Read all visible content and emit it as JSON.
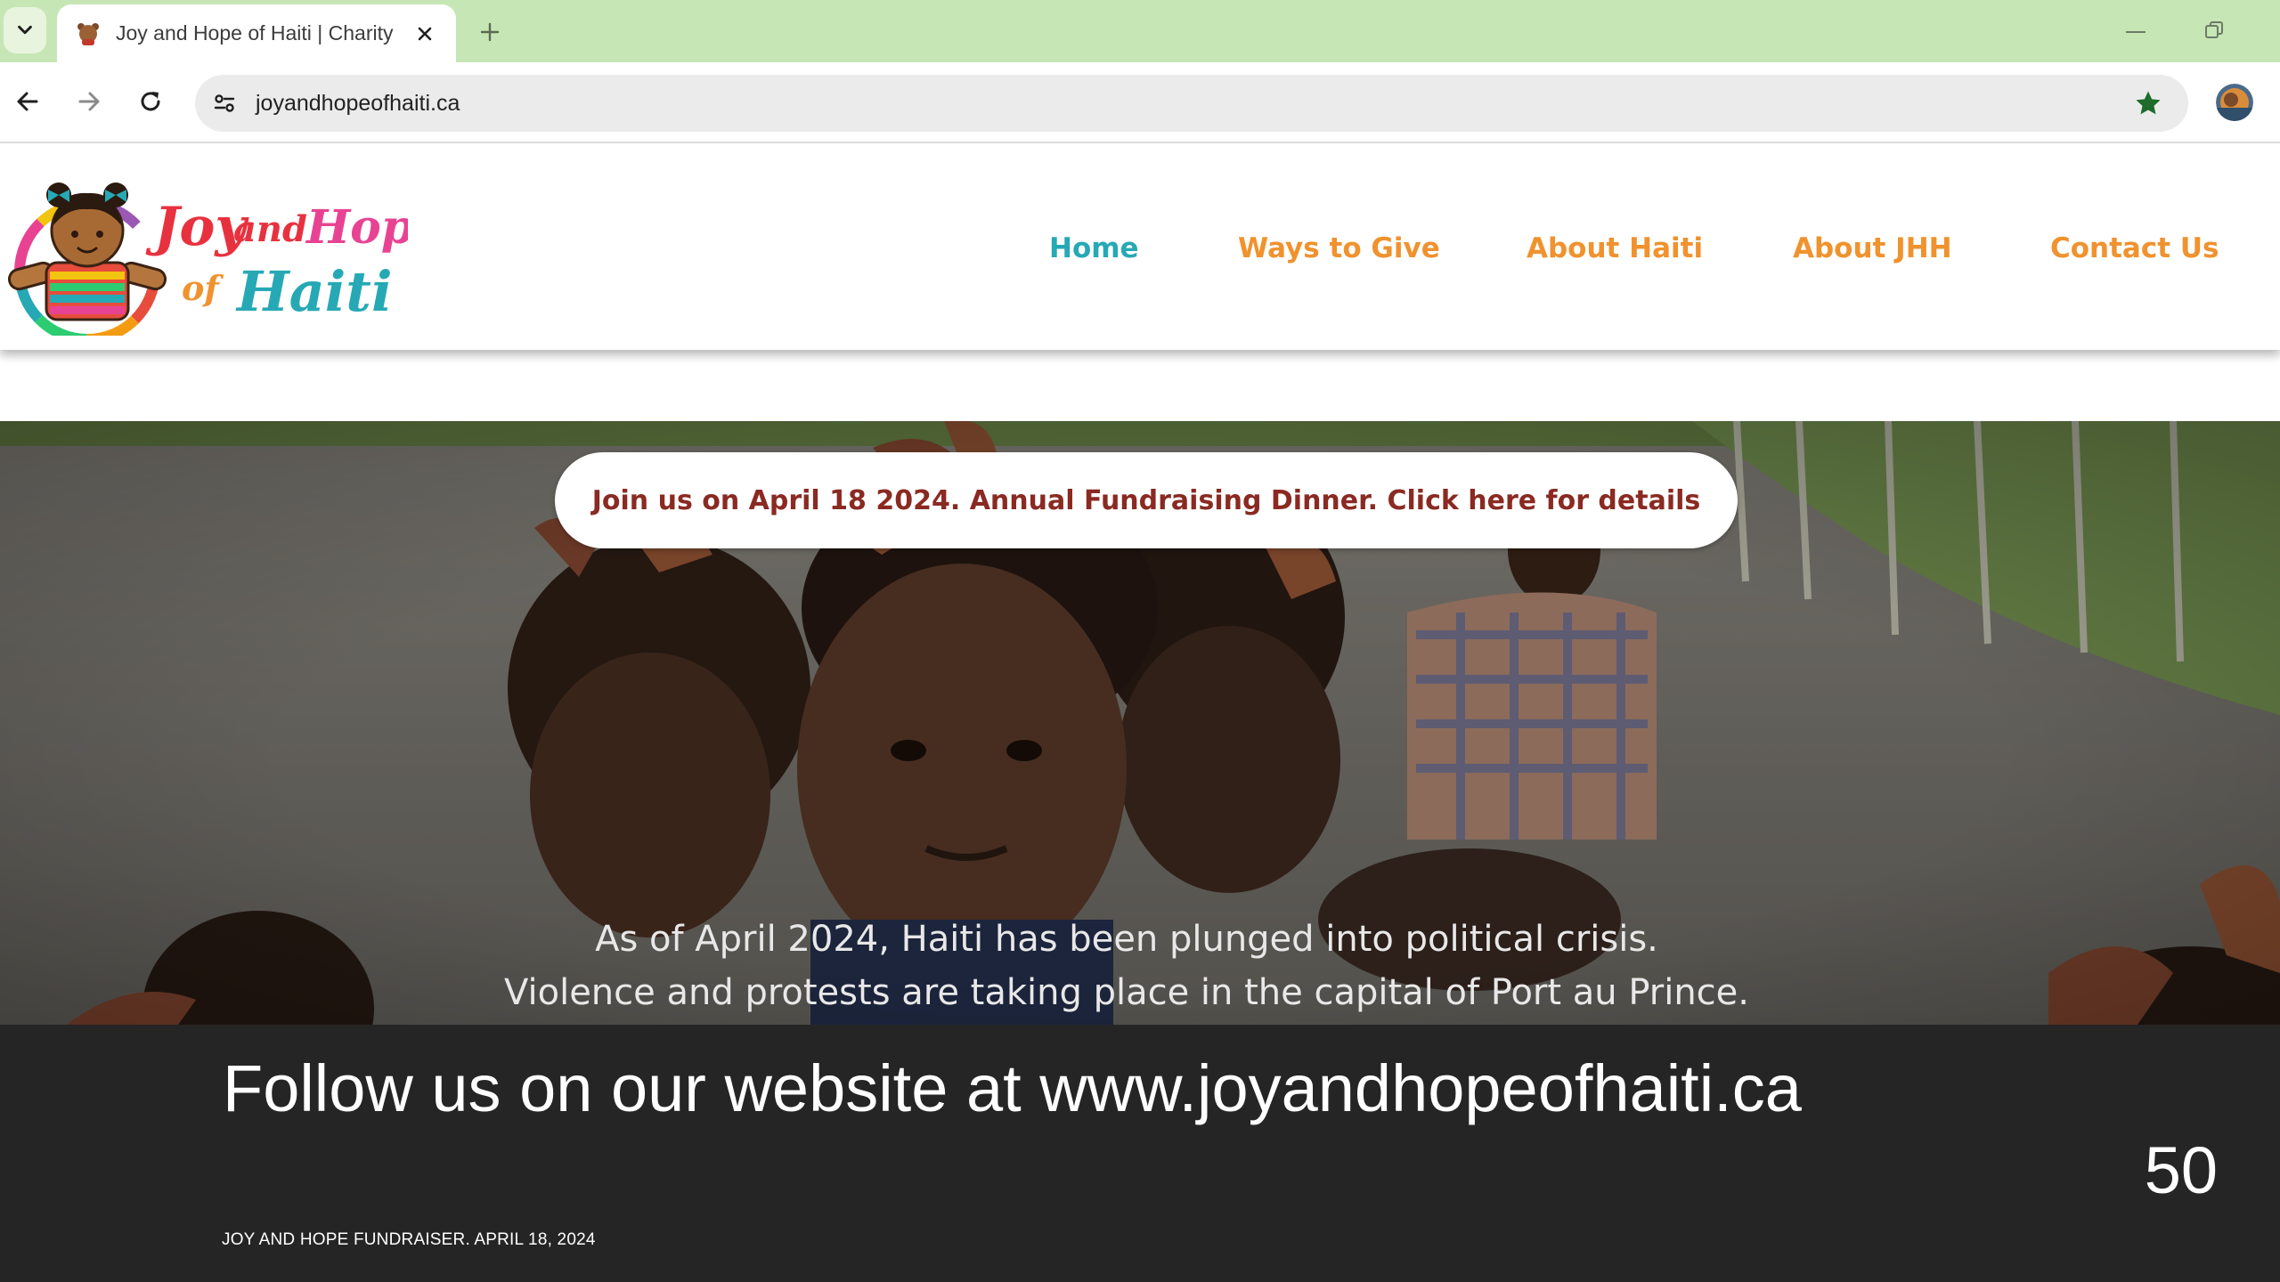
{
  "browser": {
    "tab": {
      "title": "Joy and Hope of Haiti | Charity",
      "favicon": "bear-favicon-icon"
    },
    "toolbar": {
      "url": "joyandhopeofhaiti.ca",
      "bookmark_icon": "star-filled-icon",
      "bookmark_color": "#1e6b2b"
    },
    "tabbar_color": "#c7e6b5"
  },
  "website": {
    "logo": {
      "line1_a": "Joy",
      "line1_b": "and",
      "line1_c": "Hope",
      "line2_a": "of",
      "line2_b": "Haiti"
    },
    "nav": {
      "home": "Home",
      "ways_to_give": "Ways to Give",
      "about_haiti": "About Haiti",
      "about_jhh": "About JHH",
      "contact_us": "Contact Us"
    },
    "colors": {
      "nav_active": "#26a9b5",
      "nav_default": "#f0922e",
      "cta_text": "#8a2a22"
    },
    "banner_cta": "Join us on April 18 2024. Annual Fundraising Dinner. Click here for details",
    "hero_text_line1": "As of April 2024, Haiti has been plunged into political crisis.",
    "hero_text_line2": "Violence and protests are taking place in the capital of Port au Prince."
  },
  "slide": {
    "caption": "Follow us on our website at www.joyandhopeofhaiti.ca",
    "number": "50",
    "footer": "JOY AND HOPE FUNDRAISER. APRIL 18, 2024"
  }
}
